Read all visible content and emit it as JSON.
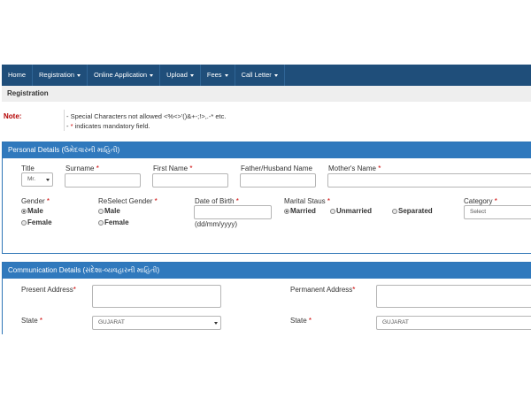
{
  "nav": {
    "items": [
      {
        "label": "Home",
        "dropdown": false
      },
      {
        "label": "Registration",
        "dropdown": true
      },
      {
        "label": "Online Application",
        "dropdown": true
      },
      {
        "label": "Upload",
        "dropdown": true
      },
      {
        "label": "Fees",
        "dropdown": true
      },
      {
        "label": "Call Letter",
        "dropdown": true
      }
    ]
  },
  "breadcrumb": "Registration",
  "note": {
    "label": "Note:",
    "line1": "- Special Characters not allowed <%<>'()&+-;!>,.-* etc.",
    "line2_prefix": "- ",
    "line2_star": "*",
    "line2_rest": " indicates mandatory field."
  },
  "personal": {
    "title": "Personal Details (ઉમેદવારની માહિતી)",
    "title_label": "Title",
    "title_value": "Mr.",
    "surname_label": "Surname",
    "firstname_label": "First Name",
    "father_label": "Father/Husband Name",
    "mother_label": "Mother's Name",
    "gender_label": "Gender",
    "reselect_label": "ReSelect Gender",
    "male": "Male",
    "female": "Female",
    "dob_label": "Date of Birth",
    "dob_hint": "(dd/mm/yyyy)",
    "marital_label": "Marital Staus",
    "married": "Married",
    "unmarried": "Unmarried",
    "separated": "Separated",
    "category_label": "Category",
    "category_value": "Select",
    "required_mark": "*"
  },
  "communication": {
    "title": "Communication Details (સંદેશા-વ્યવહારની માહિતી)",
    "present_label": "Present Address",
    "permanent_label": "Permanent Address",
    "state_label": "State",
    "state_value": "GUJARAT",
    "perm_state_value": "GUJARAT",
    "required_mark": "*"
  }
}
